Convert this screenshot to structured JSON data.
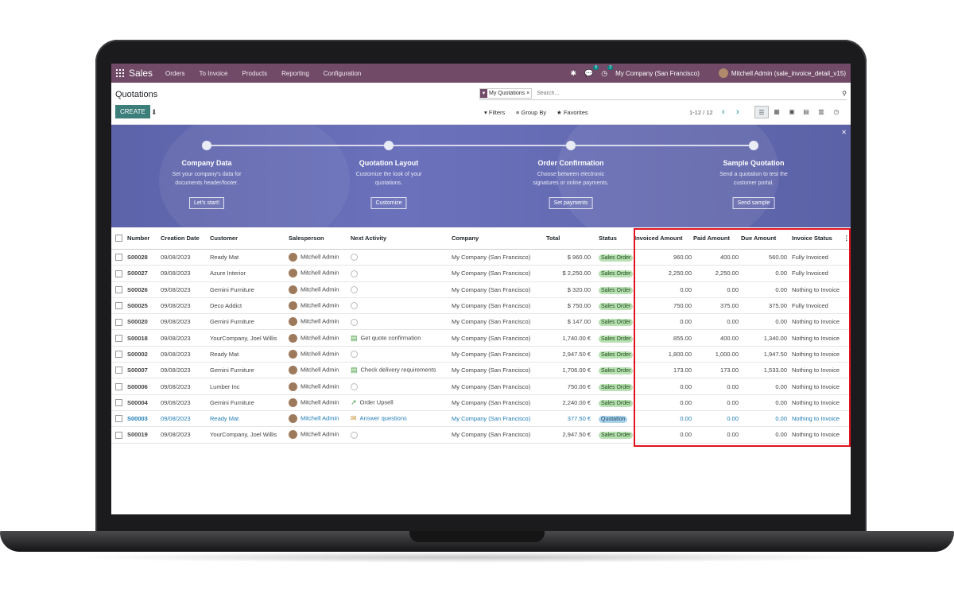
{
  "navbar": {
    "app_name": "Sales",
    "menu": [
      "Orders",
      "To Invoice",
      "Products",
      "Reporting",
      "Configuration"
    ],
    "messages_count": "5",
    "activities_count": "2",
    "company": "My Company (San Francisco)",
    "user": "Mitchell Admin (sale_invoice_detail_v15)"
  },
  "control_panel": {
    "title": "Quotations",
    "create_label": "CREATE",
    "facet_label": "My Quotations",
    "search_placeholder": "Search...",
    "filters_label": "Filters",
    "groupby_label": "Group By",
    "favorites_label": "Favorites",
    "pager": "1-12 / 12"
  },
  "banner": {
    "steps": [
      {
        "title": "Company Data",
        "desc1": "Set your company's data for",
        "desc2": "documents header/footer.",
        "button": "Let's start!"
      },
      {
        "title": "Quotation Layout",
        "desc1": "Customize the look of your",
        "desc2": "quotations.",
        "button": "Customize"
      },
      {
        "title": "Order Confirmation",
        "desc1": "Choose between electronic",
        "desc2": "signatures or online payments.",
        "button": "Set payments"
      },
      {
        "title": "Sample Quotation",
        "desc1": "Send a quotation to test the",
        "desc2": "customer portal.",
        "button": "Send sample"
      }
    ]
  },
  "table": {
    "headers": {
      "number": "Number",
      "date": "Creation Date",
      "customer": "Customer",
      "salesperson": "Salesperson",
      "activity": "Next Activity",
      "company": "Company",
      "total": "Total",
      "status": "Status",
      "invoiced": "Invoiced Amount",
      "paid": "Paid Amount",
      "due": "Due Amount",
      "invoice_status": "Invoice Status"
    },
    "rows": [
      {
        "number": "S00028",
        "date": "09/08/2023",
        "customer": "Ready Mat",
        "salesperson": "Mitchell Admin",
        "activity": "",
        "activity_icon": "clock-icon",
        "company": "My Company (San Francisco)",
        "total": "$ 960.00",
        "status": "Sales Order",
        "invoiced": "960.00",
        "paid": "400.00",
        "due": "560.00",
        "invoice_status": "Fully Invoiced"
      },
      {
        "number": "S00027",
        "date": "09/08/2023",
        "customer": "Azure Interior",
        "salesperson": "Mitchell Admin",
        "activity": "",
        "activity_icon": "clock-icon",
        "company": "My Company (San Francisco)",
        "total": "$ 2,250.00",
        "status": "Sales Order",
        "invoiced": "2,250.00",
        "paid": "2,250.00",
        "due": "0.00",
        "invoice_status": "Fully Invoiced"
      },
      {
        "number": "S00026",
        "date": "09/08/2023",
        "customer": "Gemini Furniture",
        "salesperson": "Mitchell Admin",
        "activity": "",
        "activity_icon": "clock-icon",
        "company": "My Company (San Francisco)",
        "total": "$ 320.00",
        "status": "Sales Order",
        "invoiced": "0.00",
        "paid": "0.00",
        "due": "0.00",
        "invoice_status": "Nothing to Invoice"
      },
      {
        "number": "S00025",
        "date": "09/08/2023",
        "customer": "Deco Addict",
        "salesperson": "Mitchell Admin",
        "activity": "",
        "activity_icon": "clock-icon",
        "company": "My Company (San Francisco)",
        "total": "$ 750.00",
        "status": "Sales Order",
        "invoiced": "750.00",
        "paid": "375.00",
        "due": "375.00",
        "invoice_status": "Fully Invoiced"
      },
      {
        "number": "S00020",
        "date": "09/08/2023",
        "customer": "Gemini Furniture",
        "salesperson": "Mitchell Admin",
        "activity": "",
        "activity_icon": "clock-icon",
        "company": "My Company (San Francisco)",
        "total": "$ 147.00",
        "status": "Sales Order",
        "invoiced": "0.00",
        "paid": "0.00",
        "due": "0.00",
        "invoice_status": "Nothing to Invoice"
      },
      {
        "number": "S00018",
        "date": "09/08/2023",
        "customer": "YourCompany, Joel Willis",
        "salesperson": "Mitchell Admin",
        "activity": "Get quote confirmation",
        "activity_icon": "list-icon",
        "company": "My Company (San Francisco)",
        "total": "1,740.00 €",
        "status": "Sales Order",
        "invoiced": "855.00",
        "paid": "400.00",
        "due": "1,340.00",
        "invoice_status": "Nothing to Invoice"
      },
      {
        "number": "S00002",
        "date": "09/08/2023",
        "customer": "Ready Mat",
        "salesperson": "Mitchell Admin",
        "activity": "",
        "activity_icon": "clock-icon",
        "company": "My Company (San Francisco)",
        "total": "2,947.50 €",
        "status": "Sales Order",
        "invoiced": "1,800.00",
        "paid": "1,000.00",
        "due": "1,947.50",
        "invoice_status": "Nothing to Invoice"
      },
      {
        "number": "S00007",
        "date": "09/08/2023",
        "customer": "Gemini Furniture",
        "salesperson": "Mitchell Admin",
        "activity": "Check delivery requirements",
        "activity_icon": "list-icon",
        "company": "My Company (San Francisco)",
        "total": "1,706.00 €",
        "status": "Sales Order",
        "invoiced": "173.00",
        "paid": "173.00",
        "due": "1,533.00",
        "invoice_status": "Nothing to Invoice"
      },
      {
        "number": "S00006",
        "date": "09/08/2023",
        "customer": "Lumber Inc",
        "salesperson": "Mitchell Admin",
        "activity": "",
        "activity_icon": "clock-icon",
        "company": "My Company (San Francisco)",
        "total": "750.00 €",
        "status": "Sales Order",
        "invoiced": "0.00",
        "paid": "0.00",
        "due": "0.00",
        "invoice_status": "Nothing to Invoice"
      },
      {
        "number": "S00004",
        "date": "09/08/2023",
        "customer": "Gemini Furniture",
        "salesperson": "Mitchell Admin",
        "activity": "Order Upsell",
        "activity_icon": "chart-icon",
        "company": "My Company (San Francisco)",
        "total": "2,240.00 €",
        "status": "Sales Order",
        "invoiced": "0.00",
        "paid": "0.00",
        "due": "0.00",
        "invoice_status": "Nothing to Invoice"
      },
      {
        "number": "S00003",
        "date": "09/08/2023",
        "customer": "Ready Mat",
        "salesperson": "Mitchell Admin",
        "activity": "Answer questions",
        "activity_icon": "envelope-icon",
        "company": "My Company (San Francisco)",
        "total": "377.50 €",
        "status": "Quotation",
        "invoiced": "0.00",
        "paid": "0.00",
        "due": "0.00",
        "invoice_status": "Nothing to Invoice",
        "highlight": true
      },
      {
        "number": "S00019",
        "date": "09/08/2023",
        "customer": "YourCompany, Joel Willis",
        "salesperson": "Mitchell Admin",
        "activity": "",
        "activity_icon": "clock-icon",
        "company": "My Company (San Francisco)",
        "total": "2,947.50 €",
        "status": "Sales Order",
        "invoiced": "0.00",
        "paid": "0.00",
        "due": "0.00",
        "invoice_status": "Nothing to Invoice"
      }
    ]
  },
  "colors": {
    "navbar": "#704a66",
    "primary_button": "#3b7e7a",
    "sales_order_badge": "#b8e0b2",
    "quotation_badge": "#a9d3ea",
    "highlight_frame": "#e2131e"
  }
}
